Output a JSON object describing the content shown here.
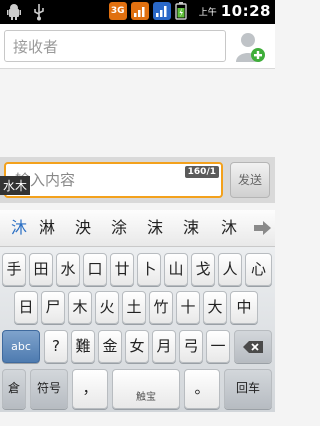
{
  "status_bar": {
    "time_label": "上午",
    "time": "10:28",
    "icons": [
      "android-icon",
      "usb-icon",
      "3g-data-icon",
      "signal-bars-icon",
      "wifi-signal-icon",
      "battery-icon"
    ],
    "network_label": "3G"
  },
  "recipient": {
    "placeholder": "接收者",
    "add_contact_icon": "add-contact-icon"
  },
  "compose": {
    "placeholder": "输入内容",
    "counter": "160/1",
    "send_label": "发送",
    "ime_composing": "水木"
  },
  "candidates": {
    "items": [
      "沐",
      "淋",
      "泱",
      "涂",
      "沫",
      "涑",
      "沐"
    ],
    "more_icon": "right-arrow-icon"
  },
  "keyboard": {
    "row1": [
      "手",
      "田",
      "水",
      "口",
      "廿",
      "卜",
      "山",
      "戈",
      "人",
      "心"
    ],
    "row2": [
      "日",
      "尸",
      "木",
      "火",
      "土",
      "竹",
      "十",
      "大",
      "中"
    ],
    "row3": [
      "abc",
      "?",
      "難",
      "金",
      "女",
      "月",
      "弓",
      "一"
    ],
    "row4": [
      "倉",
      "符号",
      "，",
      "触宝",
      "。",
      "回车"
    ],
    "accent_blue": "#4e7bb0",
    "input_focus_color": "#f3a11c"
  }
}
